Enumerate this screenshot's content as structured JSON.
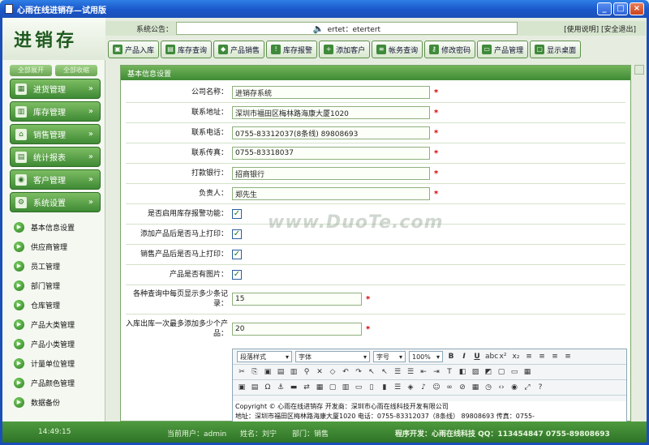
{
  "window": {
    "title": "心雨在线进销存—试用版",
    "buttons": {
      "min": "_",
      "max": "□",
      "close": "×"
    }
  },
  "logo": "进销存",
  "notice": {
    "label": "系统公告：",
    "text": "ertet：etertert",
    "links": "[使用说明] [安全退出]"
  },
  "toolbar": [
    {
      "label": "产品入库",
      "icon": "box-in-icon"
    },
    {
      "label": "库存查询",
      "icon": "book-icon"
    },
    {
      "label": "产品销售",
      "icon": "handshake-icon"
    },
    {
      "label": "库存报警",
      "icon": "alarm-icon"
    },
    {
      "label": "添加客户",
      "icon": "add-user-icon"
    },
    {
      "label": "帐务查询",
      "icon": "ledger-icon"
    },
    {
      "label": "修改密码",
      "icon": "key-icon"
    },
    {
      "label": "产品管理",
      "icon": "folder-icon"
    },
    {
      "label": "显示桌面",
      "icon": "desktop-icon"
    }
  ],
  "sidebar": {
    "tabs": [
      "全部展开",
      "全部收缩"
    ],
    "menus": [
      "进货管理",
      "库存管理",
      "销售管理",
      "统计报表",
      "客户管理",
      "系统设置"
    ],
    "subs": [
      "基本信息设置",
      "供应商管理",
      "员工管理",
      "部门管理",
      "仓库管理",
      "产品大类管理",
      "产品小类管理",
      "计量单位管理",
      "产品颜色管理",
      "数据备份"
    ]
  },
  "panel": {
    "title": "基本信息设置"
  },
  "form": {
    "company_label": "公司名称：",
    "company": "进销存系统",
    "address_label": "联系地址：",
    "address": "深圳市福田区梅林路海康大厦1020",
    "phone_label": "联系电话：",
    "phone": "0755-83312037(8条线) 89808693",
    "fax_label": "联系传真：",
    "fax": "0755-83318037",
    "bank_label": "打款银行：",
    "bank": "招商银行",
    "owner_label": "负责人：",
    "owner": "郑先生",
    "alarm_label": "是否启用库存报警功能：",
    "print_add_label": "添加产品后是否马上打印：",
    "print_sale_label": "销售产品后是否马上打印：",
    "image_label": "产品是否有图片：",
    "page_size_label": "各种查询中每页显示多少条记录：",
    "page_size": "15",
    "batch_label": "入库出库一次最多添加多少个产品：",
    "batch": "20"
  },
  "editor": {
    "style": "段落样式",
    "font": "字体",
    "size": "字号",
    "zoom": "100%",
    "content_line1": "Copyright © 心雨在线进销存  开发商：深圳市心雨在线科技开发有限公司",
    "content_line2": "地址：深圳市福田区梅林路海康大厦1020 电话：0755-83312037（8条线） 89808693 传真：0755-"
  },
  "status": {
    "time": "14:49:15",
    "user": "当前用户：admin",
    "name": "姓名：刘宁",
    "dept": "部门：销售",
    "dev": "程序开发：心雨在线科技  QQ：113454847  0755-89808693"
  },
  "watermark": "www.DuoTe.com"
}
